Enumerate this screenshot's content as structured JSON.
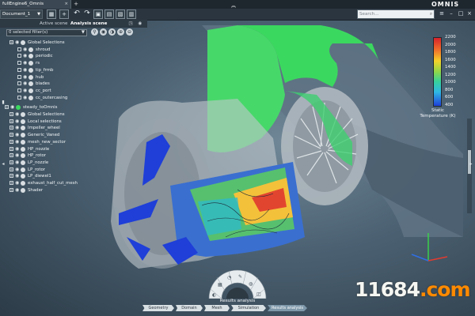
{
  "window": {
    "file_tab": "fullEngine6_Omnis",
    "file_tab_close": "×",
    "add_tab": "+",
    "brand": "OMNIS",
    "collapse": "︽"
  },
  "toolbar": {
    "document": "Document_1",
    "search_placeholder": "Search..."
  },
  "scene_tabs": {
    "active": "Active scene",
    "analysis": "Analysis scene"
  },
  "filter": {
    "label": "0 selected filter(s)"
  },
  "tree": [
    {
      "label": "Global Selections",
      "indent": 1
    },
    {
      "label": "shroud",
      "indent": 2
    },
    {
      "label": "periodic",
      "indent": 2
    },
    {
      "label": "rs",
      "indent": 2
    },
    {
      "label": "tip_frmb",
      "indent": 2
    },
    {
      "label": "hub",
      "indent": 2
    },
    {
      "label": "blades",
      "indent": 2
    },
    {
      "label": "cc_port",
      "indent": 2
    },
    {
      "label": "cc_outercasing",
      "indent": 2
    },
    {
      "label": "steady_toOmnis",
      "indent": 0
    },
    {
      "label": "Global Selections",
      "indent": 1
    },
    {
      "label": "Local selections",
      "indent": 1
    },
    {
      "label": "Impeller_wheel",
      "indent": 1
    },
    {
      "label": "Generic_Vaned",
      "indent": 1
    },
    {
      "label": "mesh_new_sector",
      "indent": 1
    },
    {
      "label": "HP_nozzle",
      "indent": 1
    },
    {
      "label": "HP_rotor",
      "indent": 1
    },
    {
      "label": "LP_nozzle",
      "indent": 1
    },
    {
      "label": "LP_rotor",
      "indent": 1
    },
    {
      "label": "LP_diewel1",
      "indent": 1
    },
    {
      "label": "exhaust_half_cut_mesh",
      "indent": 1
    },
    {
      "label": "Shader",
      "indent": 1
    }
  ],
  "legend": {
    "title": "Static Temperature (K)",
    "ticks": [
      "2200",
      "2000",
      "1800",
      "1600",
      "1400",
      "1200",
      "1000",
      "800",
      "600",
      "400"
    ],
    "colors": {
      "high": "#d8222b",
      "mid": "#8dd74a",
      "low": "#1f3fd8"
    }
  },
  "bottom": {
    "wheel_title": "Results analysis",
    "breadcrumb": [
      "Geometry",
      "Domain",
      "Mesh",
      "Simulation",
      "Results analysis"
    ],
    "active_step": "Results analysis"
  },
  "watermark": {
    "part1": "11684",
    "part2": ".com"
  },
  "icons": {
    "undo": "undo-icon",
    "redo": "redo-icon",
    "save": "save-icon"
  }
}
